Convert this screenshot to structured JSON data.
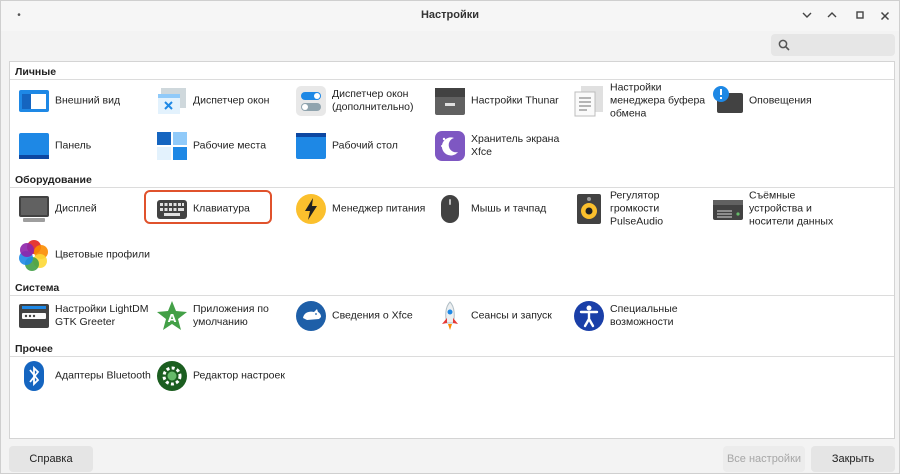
{
  "window": {
    "title": "Настройки",
    "menu_glyph": "•",
    "controls": {
      "minimize": "⌄",
      "restore": "⌃",
      "maximize": "▫",
      "close": "×"
    }
  },
  "search": {
    "value": "",
    "placeholder": ""
  },
  "categories": {
    "personal": "Личные",
    "hardware": "Оборудование",
    "system": "Система",
    "other": "Прочее"
  },
  "items": {
    "appearance": "Внешний вид",
    "window_manager": "Диспетчер окон",
    "window_manager_tweaks": "Диспетчер окон (дополнительно)",
    "thunar": "Настройки Thunar",
    "clipboard": "Настройки менеджера буфера обмена",
    "notifications": "Оповещения",
    "panel": "Панель",
    "workspaces": "Рабочие места",
    "desktop": "Рабочий стол",
    "screensaver": "Хранитель экрана Xfce",
    "display": "Дисплей",
    "keyboard": "Клавиатура",
    "power": "Менеджер питания",
    "mouse": "Мышь и тачпад",
    "pulseaudio": "Регулятор громкости PulseAudio",
    "removable": "Съёмные устройства и носители данных",
    "color_profiles": "Цветовые профили",
    "lightdm": "Настройки LightDM GTK Greeter",
    "default_apps": "Приложения по умолчанию",
    "about": "Сведения о Xfce",
    "sessions": "Сеансы и запуск",
    "accessibility": "Специальные возможности",
    "bluetooth": "Адаптеры Bluetooth",
    "settings_editor": "Редактор настроек"
  },
  "footer": {
    "help": "Справка",
    "all_settings": "Все настройки",
    "close": "Закрыть"
  },
  "colors": {
    "highlight": "#e0522c",
    "accent": "#1e88e5"
  }
}
